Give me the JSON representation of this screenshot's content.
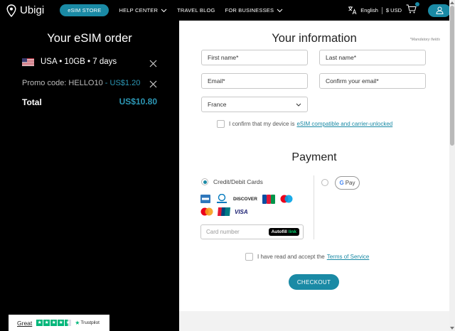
{
  "nav": {
    "logo_text": "Ubigi",
    "esim_store": "eSIM STORE",
    "help_center": "HELP CENTER",
    "travel_blog": "TRAVEL BLOG",
    "for_businesses": "FOR BUSINESSES",
    "language": "English",
    "currency": "$ USD"
  },
  "order": {
    "title": "Your eSIM order",
    "plan": "USA • 10GB • 7 days",
    "promo_label": "Promo code: HELLO10",
    "promo_amount": "- US$1.20",
    "total_label": "Total",
    "total_value": "US$10.80"
  },
  "info": {
    "title": "Your information",
    "mandatory": "*Mandatory fields",
    "first_name": "First name*",
    "last_name": "Last name*",
    "email": "Email*",
    "confirm_email": "Confirm your email*",
    "country": "France",
    "compat_text": "I confirm that my device is",
    "compat_link": "eSIM compatible and carrier-unlocked"
  },
  "payment": {
    "title": "Payment",
    "card_option": "Credit/Debit Cards",
    "gpay_label": "Pay",
    "card_number_placeholder": "Card number",
    "autofill": "Autofill",
    "autofill_link": "link",
    "terms_text": "I have read and accept the",
    "terms_link": "Terms of Service",
    "checkout": "CHECKOUT",
    "card_brands": [
      "amex",
      "diners-club",
      "discover",
      "jcb",
      "maestro",
      "mastercard",
      "union-pay",
      "visa"
    ],
    "discover_text": "DISCOVER",
    "visa_text": "VISA"
  },
  "trustpilot": {
    "rating_word": "Great",
    "brand": "Trustpilot",
    "stars": 4.5
  },
  "colors": {
    "accent": "#1a8aa5",
    "dark_panel": "#000000",
    "trustpilot_green": "#00b67a"
  }
}
